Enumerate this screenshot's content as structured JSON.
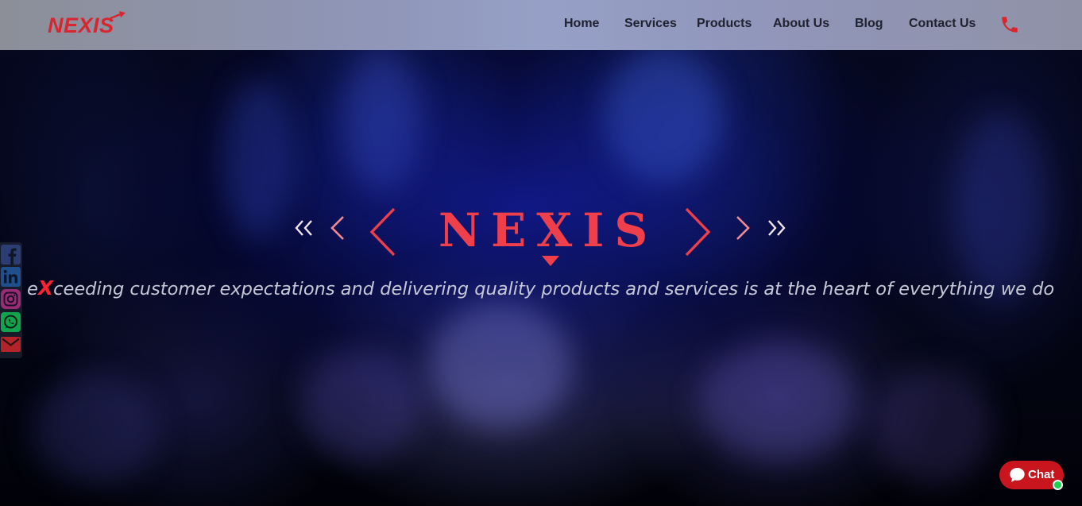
{
  "header": {
    "logo_text": "NEXIS",
    "nav": [
      {
        "label": "Home"
      },
      {
        "label": "Services"
      },
      {
        "label": "Products"
      },
      {
        "label": "About Us"
      },
      {
        "label": "Blog"
      },
      {
        "label": "Contact Us"
      }
    ],
    "phone_icon": "phone-icon"
  },
  "hero": {
    "brand": "NEXIS",
    "tagline_prefix": "e",
    "tagline_accent": "X",
    "tagline_rest": "ceeding customer expectations and delivering quality products and services is at the heart of everything we do"
  },
  "social": [
    {
      "icon": "facebook-icon",
      "color": "#3b5998"
    },
    {
      "icon": "linkedin-icon",
      "color": "#0a66c2"
    },
    {
      "icon": "instagram-icon",
      "color": "#c13584"
    },
    {
      "icon": "whatsapp-icon",
      "color": "#25d366"
    },
    {
      "icon": "email-icon",
      "color": "#d93025"
    }
  ],
  "chat": {
    "label": "Chat"
  },
  "colors": {
    "brand_red": "#d8252e",
    "accent_red": "#ef3f4a",
    "chat_red": "#c9161e",
    "online_green": "#19d34d"
  }
}
